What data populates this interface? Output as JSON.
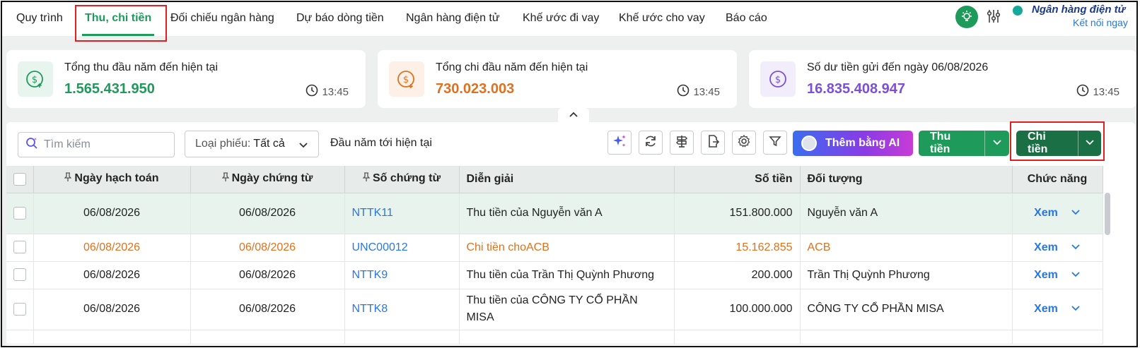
{
  "nav": {
    "tabs": [
      {
        "label": "Quy trình"
      },
      {
        "label": "Thu, chi tiền"
      },
      {
        "label": "Đối chiếu ngân hàng"
      },
      {
        "label": "Dự báo dòng tiền"
      },
      {
        "label": "Ngân hàng điện tử"
      },
      {
        "label": "Khế ước đi vay"
      },
      {
        "label": "Khế ước cho vay"
      },
      {
        "label": "Báo cáo"
      }
    ],
    "active_tab": "Thu, chi tiền",
    "bank_title": "Ngân hàng điện tử",
    "bank_link": "Kết nối ngay",
    "icons": [
      "bulb-icon",
      "sliders-icon"
    ]
  },
  "cards": [
    {
      "label": "Tổng thu đầu năm đến hiện tại",
      "value": "1.565.431.950",
      "time": "13:45",
      "color": "#1e9a5b"
    },
    {
      "label": "Tổng chi đầu năm đến hiện tại",
      "value": "730.023.003",
      "time": "13:45",
      "color": "#e0711c"
    },
    {
      "label": "Số dư tiền gửi đến ngày 06/08/2026",
      "value": "16.835.408.947",
      "time": "13:45",
      "color": "#7b4fd6"
    }
  ],
  "toolbar": {
    "search_placeholder": "Tìm kiếm",
    "filter_label": "Loại phiếu:",
    "filter_value": "Tất cả",
    "period": "Đầu năm tới hiện tại",
    "ai_button": "Thêm bằng AI",
    "receive_button": "Thu tiền",
    "pay_button": "Chi tiền"
  },
  "table": {
    "columns": [
      "Ngày hạch toán",
      "Ngày chứng từ",
      "Số chứng từ",
      "Diễn giải",
      "Số tiền",
      "Đối tượng",
      "Chức năng"
    ],
    "rows": [
      {
        "posting_date": "06/08/2026",
        "doc_date": "06/08/2026",
        "doc_no": "NTTK11",
        "desc": "Thu tiền của Nguyễn văn A",
        "amount": "151.800.000",
        "party": "Nguyễn văn A",
        "action": "Xem"
      },
      {
        "posting_date": "06/08/2026",
        "doc_date": "06/08/2026",
        "doc_no": "UNC00012",
        "desc": "Chi tiền choACB",
        "amount": "15.162.855",
        "party": "ACB",
        "action": "Xem"
      },
      {
        "posting_date": "06/08/2026",
        "doc_date": "06/08/2026",
        "doc_no": "NTTK9",
        "desc": "Thu tiền của Trần Thị Quỳnh Phương",
        "amount": "200.000",
        "party": "Trần Thị Quỳnh Phương",
        "action": "Xem"
      },
      {
        "posting_date": "06/08/2026",
        "doc_date": "06/08/2026",
        "doc_no": "NTTK8",
        "desc": "Thu tiền của CÔNG TY CỔ PHẦN MISA",
        "amount": "100.000.000",
        "party": "CÔNG TY CỔ PHẦN MISA",
        "action": "Xem"
      }
    ]
  },
  "colors": {
    "accent": "#1e9a5b",
    "expense": "#e0711c",
    "link": "#2877e6",
    "highlight": "#e02020"
  }
}
